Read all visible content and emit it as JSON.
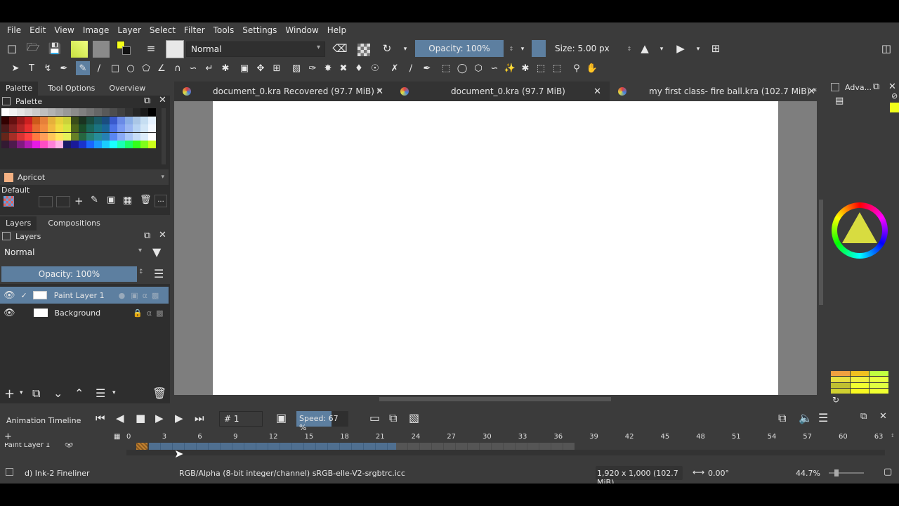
{
  "menu": [
    "File",
    "Edit",
    "View",
    "Image",
    "Layer",
    "Select",
    "Filter",
    "Tools",
    "Settings",
    "Window",
    "Help"
  ],
  "toolbar": {
    "blend_mode": "Normal",
    "opacity_label": "Opacity: 100%",
    "size_label": "Size: 5.00 px"
  },
  "left_tabs": [
    "Palette",
    "Tool Options",
    "Overview"
  ],
  "palette": {
    "title": "Palette",
    "current_color_name": "Apricot",
    "current_color_hex": "#f5b183",
    "set_name": "Default",
    "colors": [
      "#ffffff",
      "#f2f2f2",
      "#e6e6e6",
      "#d9d9d9",
      "#cccccc",
      "#bfbfbf",
      "#b3b3b3",
      "#a6a6a6",
      "#999999",
      "#8c8c8c",
      "#808080",
      "#737373",
      "#666666",
      "#595959",
      "#4d4d4d",
      "#404040",
      "#333333",
      "#262626",
      "#1a1a1a",
      "#000000",
      "#330000",
      "#661010",
      "#991a1a",
      "#cc2020",
      "#cc5a1a",
      "#e6803a",
      "#e6b03a",
      "#e6d23a",
      "#ccd23a",
      "#3a4d1a",
      "#1a3320",
      "#1a4d40",
      "#1a5a66",
      "#1a4d80",
      "#3a5acc",
      "#6a8ae6",
      "#8aaee6",
      "#aac6e6",
      "#c6def2",
      "#e6f2ff",
      "#4d1a1a",
      "#802020",
      "#b32626",
      "#e62e2e",
      "#e66a2e",
      "#f28c40",
      "#f2b840",
      "#f2dc40",
      "#d6e640",
      "#4d661a",
      "#1a4d2a",
      "#1a665a",
      "#1a7380",
      "#1a6699",
      "#4d73e6",
      "#7a9af2",
      "#9ab6f2",
      "#b6d2f2",
      "#d2e6f7",
      "#f2f8ff",
      "#66261a",
      "#a62e26",
      "#d93333",
      "#ff4040",
      "#ff7a40",
      "#ff9f59",
      "#ffc659",
      "#ffe659",
      "#e6f259",
      "#668026",
      "#266640",
      "#268073",
      "#268c99",
      "#2680b3",
      "#5a86f2",
      "#8aaaf7",
      "#aac6f7",
      "#c6dcf7",
      "#dcecfa",
      "#ffffff",
      "#331a33",
      "#4d1a4d",
      "#801a80",
      "#b31ab3",
      "#e61ae6",
      "#ff4dc4",
      "#ff80d9",
      "#ffb3e6",
      "#1a1a66",
      "#1a1a99",
      "#1a33cc",
      "#1a66ff",
      "#1a99ff",
      "#1accff",
      "#1affff",
      "#1affb3",
      "#1aff66",
      "#33ff1a",
      "#80ff1a",
      "#ccff1a"
    ],
    "tool_icons": [
      "add-icon",
      "edit-icon",
      "save-icon",
      "grid-icon",
      "delete-icon",
      "more-icon"
    ]
  },
  "layers_tabs": [
    "Layers",
    "Compositions"
  ],
  "layers": {
    "title": "Layers",
    "blend_mode": "Normal",
    "opacity_label": "Opacity:  100%",
    "items": [
      {
        "name": "Paint Layer 1",
        "selected": true
      },
      {
        "name": "Background",
        "selected": false
      }
    ]
  },
  "documents": [
    {
      "title": "document_0.kra Recovered (97.7 MiB) *"
    },
    {
      "title": "document_0.kra (97.7 MiB)"
    },
    {
      "title": "my first class- fire ball.kra (102.7 MiB) *"
    }
  ],
  "right_panel": {
    "title": "Adva..."
  },
  "timeline": {
    "title": "Animation Timeline",
    "frame_label": "# 1",
    "speed_label": "Speed: 67 %",
    "layer_name": "Paint Layer 1",
    "ruler": [
      "0",
      "3",
      "6",
      "9",
      "12",
      "15",
      "18",
      "21",
      "24",
      "27",
      "30",
      "33",
      "36",
      "39",
      "42",
      "45",
      "48",
      "51",
      "54",
      "57",
      "60",
      "63"
    ]
  },
  "status": {
    "brush": "d) Ink-2 Fineliner",
    "color_space": "RGB/Alpha (8-bit integer/channel)  sRGB-elle-V2-srgbtrc.icc",
    "dimensions": "1,920 x 1,000 (102.7 MiB)",
    "rotation": "0.00°",
    "zoom": "44.7%"
  }
}
